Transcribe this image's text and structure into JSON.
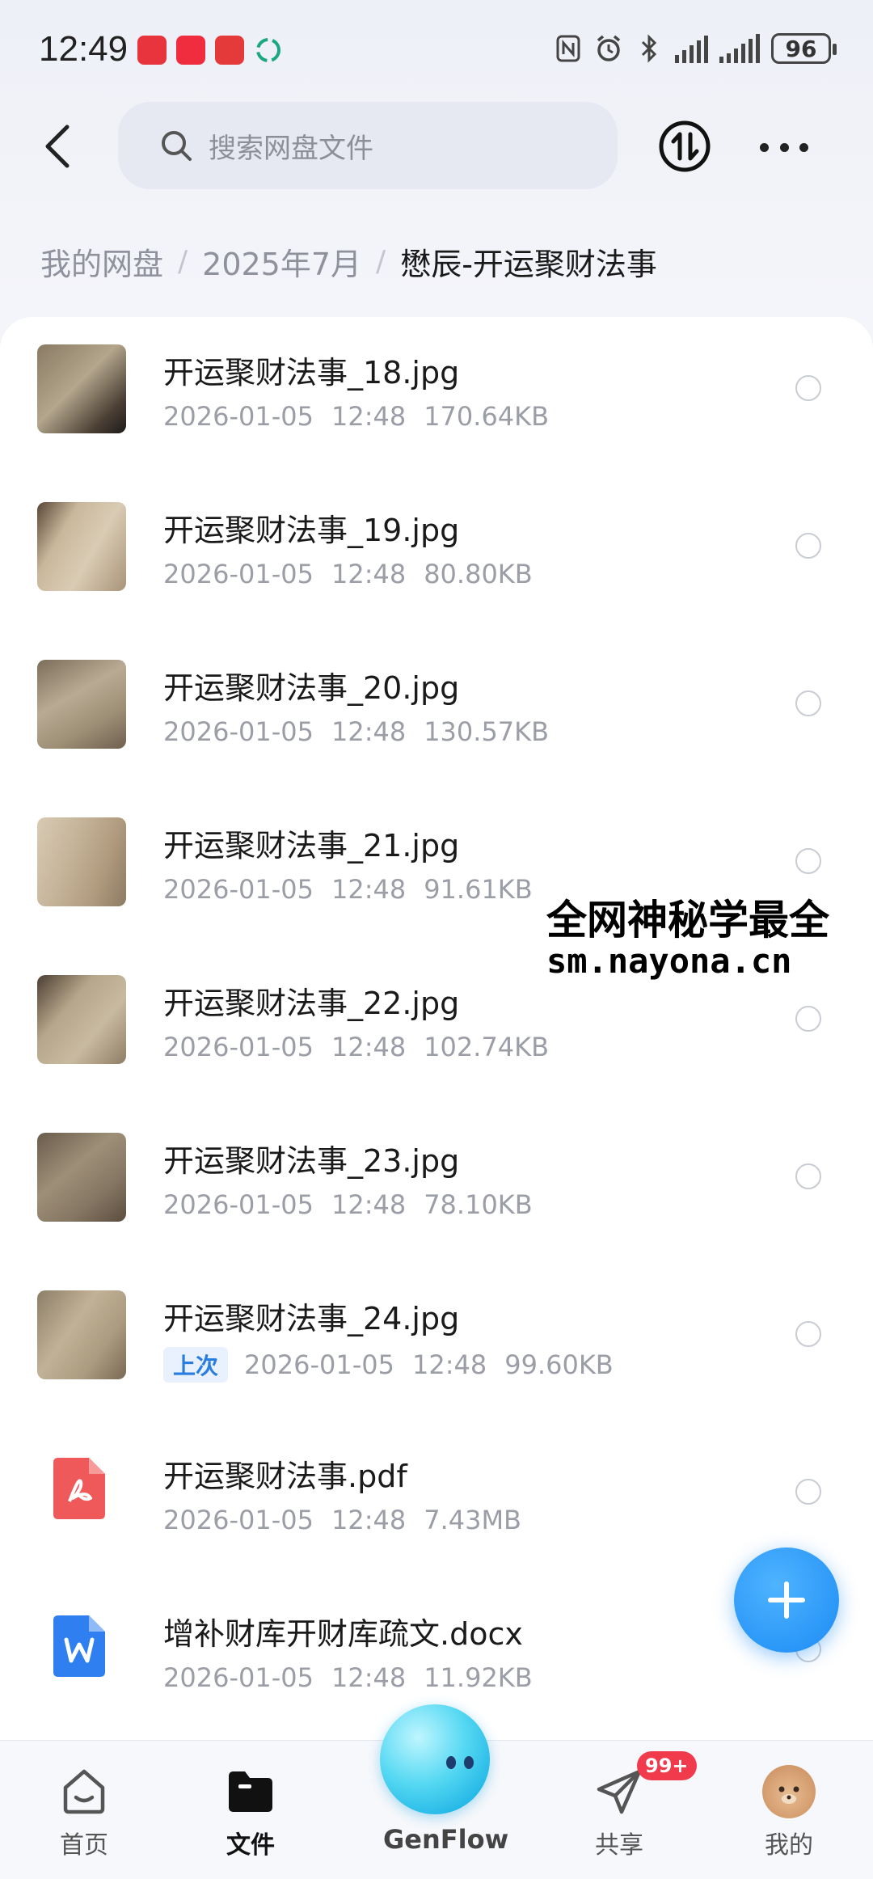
{
  "status_bar": {
    "time": "12:49",
    "battery": "96"
  },
  "search": {
    "placeholder": "搜索网盘文件"
  },
  "breadcrumb": {
    "items": [
      "我的网盘",
      "2025年7月",
      "懋辰-开运聚财法事"
    ]
  },
  "files": [
    {
      "name": "开运聚财法事_18.jpg",
      "date": "2026-01-05",
      "time": "12:48",
      "size": "170.64KB",
      "type": "image"
    },
    {
      "name": "开运聚财法事_19.jpg",
      "date": "2026-01-05",
      "time": "12:48",
      "size": "80.80KB",
      "type": "image"
    },
    {
      "name": "开运聚财法事_20.jpg",
      "date": "2026-01-05",
      "time": "12:48",
      "size": "130.57KB",
      "type": "image"
    },
    {
      "name": "开运聚财法事_21.jpg",
      "date": "2026-01-05",
      "time": "12:48",
      "size": "91.61KB",
      "type": "image"
    },
    {
      "name": "开运聚财法事_22.jpg",
      "date": "2026-01-05",
      "time": "12:48",
      "size": "102.74KB",
      "type": "image"
    },
    {
      "name": "开运聚财法事_23.jpg",
      "date": "2026-01-05",
      "time": "12:48",
      "size": "78.10KB",
      "type": "image"
    },
    {
      "name": "开运聚财法事_24.jpg",
      "date": "2026-01-05",
      "time": "12:48",
      "size": "99.60KB",
      "type": "image",
      "tag": "上次"
    },
    {
      "name": "开运聚财法事.pdf",
      "date": "2026-01-05",
      "time": "12:48",
      "size": "7.43MB",
      "type": "pdf"
    },
    {
      "name": "增补财库开财库疏文.docx",
      "date": "2026-01-05",
      "time": "12:48",
      "size": "11.92KB",
      "type": "docx"
    }
  ],
  "watermark": {
    "line1": "全网神秘学最全",
    "line2": "sm.nayona.cn"
  },
  "bottom_nav": {
    "home": "首页",
    "files": "文件",
    "genflow": "GenFlow",
    "share": "共享",
    "share_badge": "99+",
    "me": "我的"
  },
  "colors": {
    "accent": "#1b8cf5",
    "badge": "#f23a4d",
    "pdf": "#f0595a",
    "word": "#2f7ff0"
  }
}
